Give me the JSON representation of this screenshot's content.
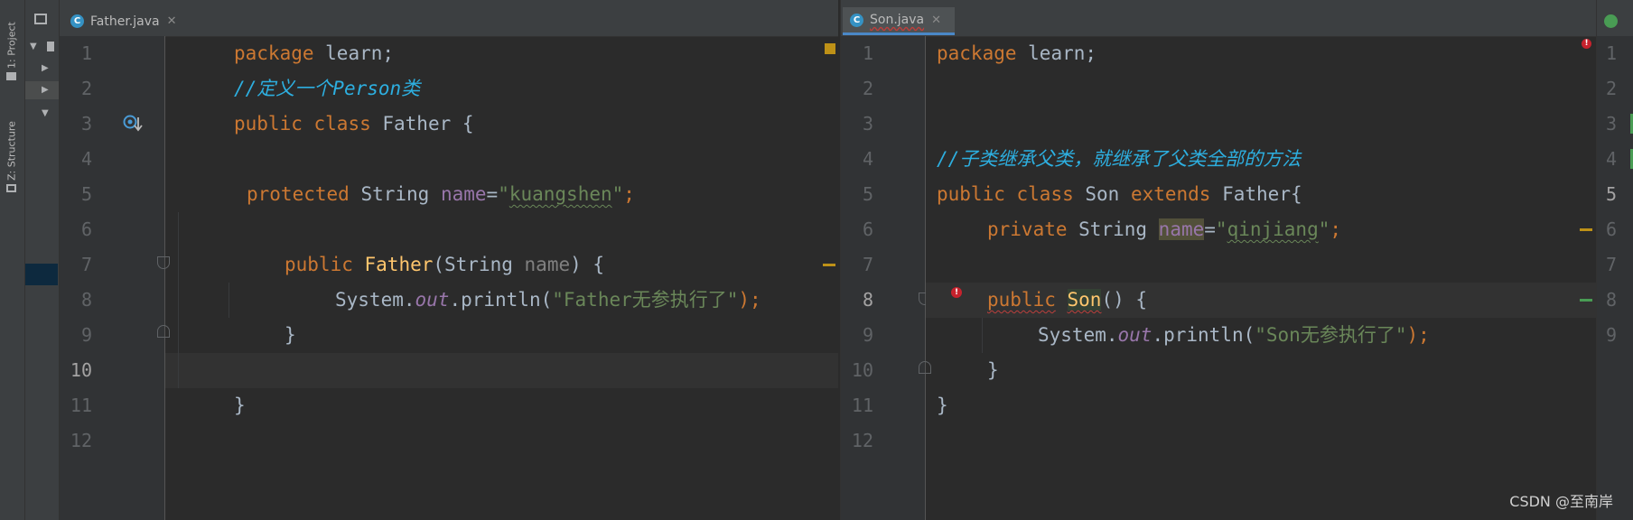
{
  "sidebar": {
    "tabs": [
      {
        "label": "1: Project",
        "icon": "folder-icon"
      },
      {
        "label": "Z: Structure",
        "icon": "structure-icon"
      }
    ]
  },
  "left_editor": {
    "tab": {
      "name": "Father.java",
      "icon_letter": "C"
    },
    "line_numbers": [
      "1",
      "2",
      "3",
      "4",
      "5",
      "6",
      "7",
      "8",
      "9",
      "10",
      "11",
      "12"
    ],
    "current_line": "10",
    "lines": {
      "l1": {
        "kw": "package",
        "rest": " learn;"
      },
      "l2": {
        "comment_prefix": "//",
        "comment": "定义一个Person类"
      },
      "l3": {
        "kw1": "public",
        "kw2": "class",
        "rest": " Father {"
      },
      "l5": {
        "kw": "protected",
        "type": " String ",
        "field": "name",
        "eq": "=",
        "q1": "\"",
        "str": "kuangshen",
        "q2": "\"",
        "semi": ";"
      },
      "l7": {
        "kw": "public",
        "fn": "Father",
        "open": "(String ",
        "param": "name",
        "close": ") {"
      },
      "l8": {
        "recv": "System.",
        "field": "out",
        "call": ".println(",
        "str": "\"Father无参执行了\"",
        "end": ");"
      },
      "l9": {
        "brace": "}"
      },
      "l11": {
        "brace": "}"
      }
    }
  },
  "right_editor": {
    "tab": {
      "name": "Son.java",
      "icon_letter": "C"
    },
    "line_numbers": [
      "1",
      "2",
      "3",
      "4",
      "5",
      "6",
      "7",
      "8",
      "9",
      "10",
      "11",
      "12"
    ],
    "current_line": "8",
    "lines": {
      "l1": {
        "kw": "package",
        "rest": " learn;"
      },
      "l4": {
        "comment_prefix": "//",
        "comment": "子类继承父类，就继承了父类全部的方法"
      },
      "l5": {
        "kw1": "public",
        "kw2": "class",
        "name": " Son ",
        "kw3": "extends",
        "rest": " Father{"
      },
      "l6": {
        "kw": "private",
        "type": " String ",
        "field": "name",
        "eq": "=",
        "q1": "\"",
        "str": "qinjiang",
        "q2": "\"",
        "semi": ";"
      },
      "l8": {
        "kw": "public",
        "fn": "Son",
        "rest": "() {"
      },
      "l9": {
        "recv": "System.",
        "field": "out",
        "call": ".println(",
        "str": "\"Son无参执行了\"",
        "end": ");"
      },
      "l10": {
        "brace": "}"
      },
      "l11": {
        "brace": "}"
      }
    }
  },
  "third_editor": {
    "line_numbers": [
      "1",
      "2",
      "3",
      "4",
      "5",
      "6",
      "7",
      "8",
      "9"
    ],
    "current_line": "5"
  },
  "watermark": "CSDN @至南岸",
  "colors": {
    "keyword": "#cc7832",
    "string": "#6a8759",
    "field": "#9876aa",
    "function": "#ffc66d",
    "comment_blue": "#2dafe0",
    "tab_accent": "#4a88c7",
    "error": "#c7222d"
  }
}
